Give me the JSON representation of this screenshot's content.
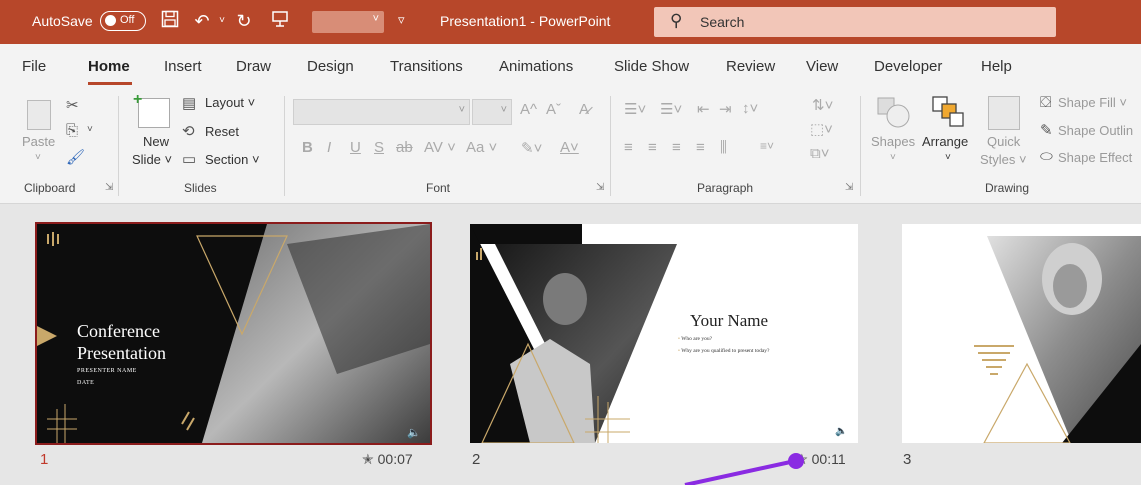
{
  "titlebar": {
    "autosave_label": "AutoSave",
    "toggle_state": "Off",
    "doc_title": "Presentation1  -  PowerPoint",
    "search_label": "Search"
  },
  "tabs": [
    "File",
    "Home",
    "Insert",
    "Draw",
    "Design",
    "Transitions",
    "Animations",
    "Slide Show",
    "Review",
    "View",
    "Developer",
    "Help"
  ],
  "ribbon": {
    "clipboard": {
      "paste": "Paste",
      "group": "Clipboard"
    },
    "slides": {
      "new_line1": "New",
      "new_line2": "Slide ˅",
      "layout": "Layout ˅",
      "reset": "Reset",
      "section": "Section ˅",
      "group": "Slides"
    },
    "font": {
      "group": "Font",
      "bold": "B",
      "italic": "I",
      "underline": "U",
      "shadow": "S",
      "strike": "ab",
      "spacing": "AV ˅",
      "case": "Aa ˅",
      "grow": "A^",
      "shrink": "Aˇ"
    },
    "paragraph": {
      "group": "Paragraph"
    },
    "drawing": {
      "shapes": "Shapes",
      "arrange": "Arrange",
      "quick1": "Quick",
      "quick2": "Styles ˅",
      "fill": "Shape Fill ˅",
      "outline": "Shape Outlin",
      "effects": "Shape Effect",
      "group": "Drawing"
    }
  },
  "slides": [
    {
      "number": "1",
      "time": "00:07",
      "title1": "Conference",
      "title2": "Presentation",
      "sub1": "PRESENTER NAME",
      "sub2": "DATE"
    },
    {
      "number": "2",
      "time": "00:11",
      "title": "Your Name",
      "bullet1": "Who are you?",
      "bullet2": "Why are you qualified to present today?"
    },
    {
      "number": "3"
    }
  ],
  "colors": {
    "accent": "#b7472a",
    "gold": "#c9a86a",
    "selection": "#8b1c1c",
    "annotation": "#8a2be2"
  }
}
